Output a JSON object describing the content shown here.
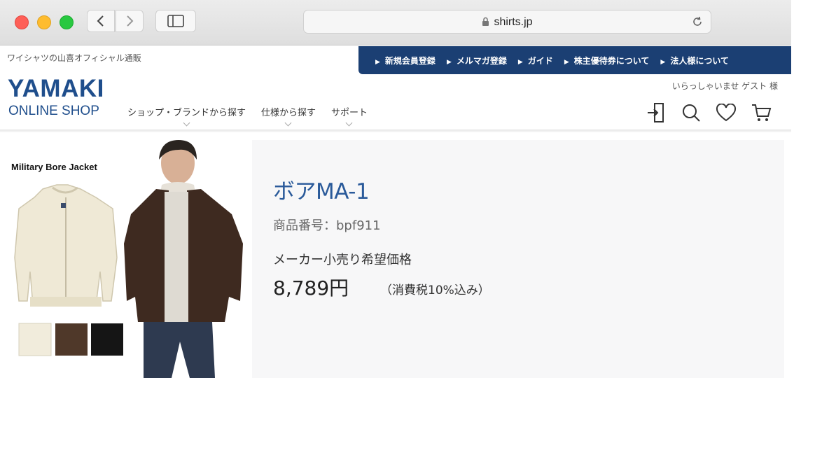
{
  "browser": {
    "url": "shirts.jp"
  },
  "header": {
    "tagline": "ワイシャツの山喜オフィシャル通販",
    "util_links": [
      "新規会員登録",
      "メルマガ登録",
      "ガイド",
      "株主優待券について",
      "法人様について"
    ],
    "logo_top": "YAMAKI",
    "logo_bottom": "ONLINE SHOP",
    "nav": [
      "ショップ・ブランドから探す",
      "仕様から探す",
      "サポート"
    ],
    "greeting": "いらっしゃいませ ゲスト 様",
    "icons": [
      "login-icon",
      "search-icon",
      "heart-icon",
      "cart-icon"
    ]
  },
  "product": {
    "image_caption": "Military Bore Jacket",
    "title": "ボアMA-1",
    "code": "商品番号：bpf911",
    "price_label": "メーカー小売り希望価格",
    "price": "8,789円",
    "tax_note": "（消費税10%込み）",
    "swatch_colors": [
      "#f1ecdc",
      "#4f3829",
      "#151515"
    ]
  },
  "colors": {
    "accent": "#1b3f73",
    "logo": "#1f4e8c",
    "title": "#2a5a9a"
  }
}
